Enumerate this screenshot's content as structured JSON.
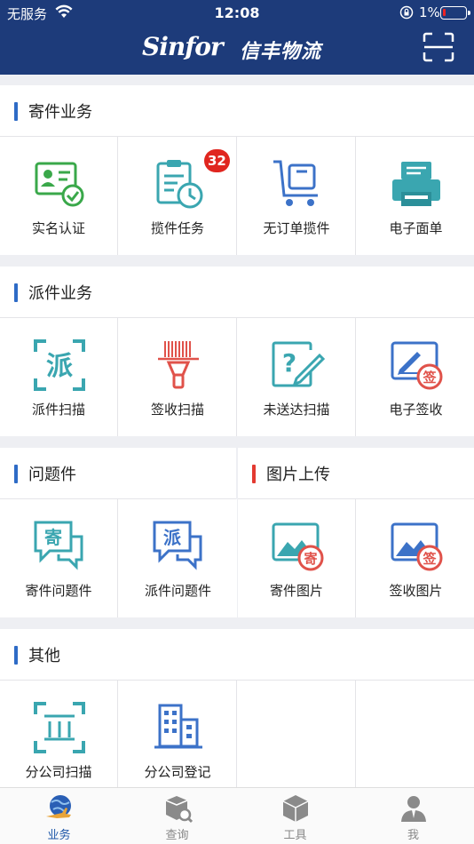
{
  "status_bar": {
    "carrier": "无服务",
    "time": "12:08",
    "battery": "1%"
  },
  "header": {
    "brand_latin": "Sinfor",
    "brand_cn": "信丰物流"
  },
  "sections": {
    "send": {
      "title": "寄件业务",
      "items": [
        {
          "label": "实名认证",
          "icon": "id-card-check-icon"
        },
        {
          "label": "揽件任务",
          "icon": "clipboard-clock-icon",
          "badge": "32"
        },
        {
          "label": "无订单揽件",
          "icon": "cart-box-icon"
        },
        {
          "label": "电子面单",
          "icon": "printer-icon"
        }
      ]
    },
    "dispatch": {
      "title": "派件业务",
      "items": [
        {
          "label": "派件扫描",
          "icon": "scan-pai-icon",
          "glyph": "派"
        },
        {
          "label": "签收扫描",
          "icon": "barcode-scanner-icon"
        },
        {
          "label": "未送达扫描",
          "icon": "question-edit-icon"
        },
        {
          "label": "电子签收",
          "icon": "sign-edit-icon",
          "glyph": "签"
        }
      ]
    },
    "problem": {
      "title": "问题件",
      "items": [
        {
          "label": "寄件问题件",
          "icon": "chat-ji-icon",
          "glyph": "寄"
        },
        {
          "label": "派件问题件",
          "icon": "chat-pai-icon",
          "glyph": "派"
        }
      ]
    },
    "photo": {
      "title": "图片上传",
      "items": [
        {
          "label": "寄件图片",
          "icon": "image-ji-icon",
          "glyph": "寄"
        },
        {
          "label": "签收图片",
          "icon": "image-qian-icon",
          "glyph": "签"
        }
      ]
    },
    "other": {
      "title": "其他",
      "items": [
        {
          "label": "分公司扫描",
          "icon": "branch-scan-icon"
        },
        {
          "label": "分公司登记",
          "icon": "building-icon"
        }
      ]
    }
  },
  "tabs": [
    {
      "label": "业务",
      "icon": "globe-plane-icon",
      "active": true
    },
    {
      "label": "查询",
      "icon": "box-search-icon"
    },
    {
      "label": "工具",
      "icon": "cube-icon"
    },
    {
      "label": "我",
      "icon": "user-icon"
    }
  ],
  "colors": {
    "header": "#1d3b7a",
    "accent_blue": "#2e6bc6",
    "accent_red": "#e33a31",
    "teal": "#3aa6b0",
    "green": "#3aa84a",
    "badge": "#e0261f"
  }
}
